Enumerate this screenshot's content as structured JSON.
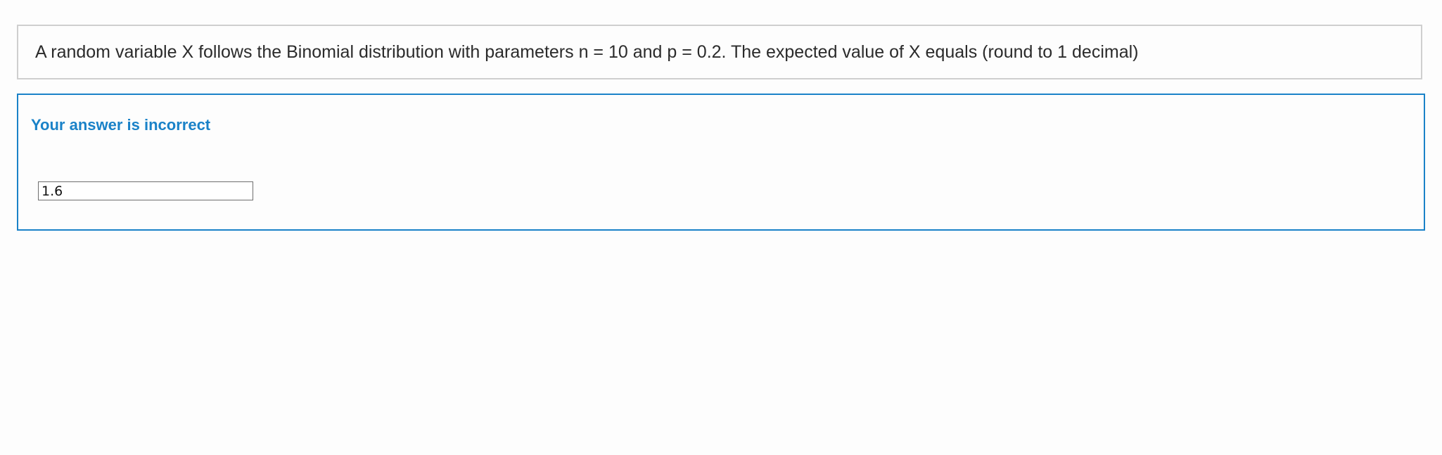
{
  "question": {
    "text": "A random variable X follows the Binomial distribution with parameters n = 10 and p = 0.2. The expected value of X equals (round to 1 decimal)"
  },
  "feedback": {
    "status_text": "Your answer is incorrect",
    "answer_value": "1.6"
  },
  "colors": {
    "accent": "#1a82c8",
    "question_border": "#cfcfcf",
    "text": "#2b2b2b"
  }
}
